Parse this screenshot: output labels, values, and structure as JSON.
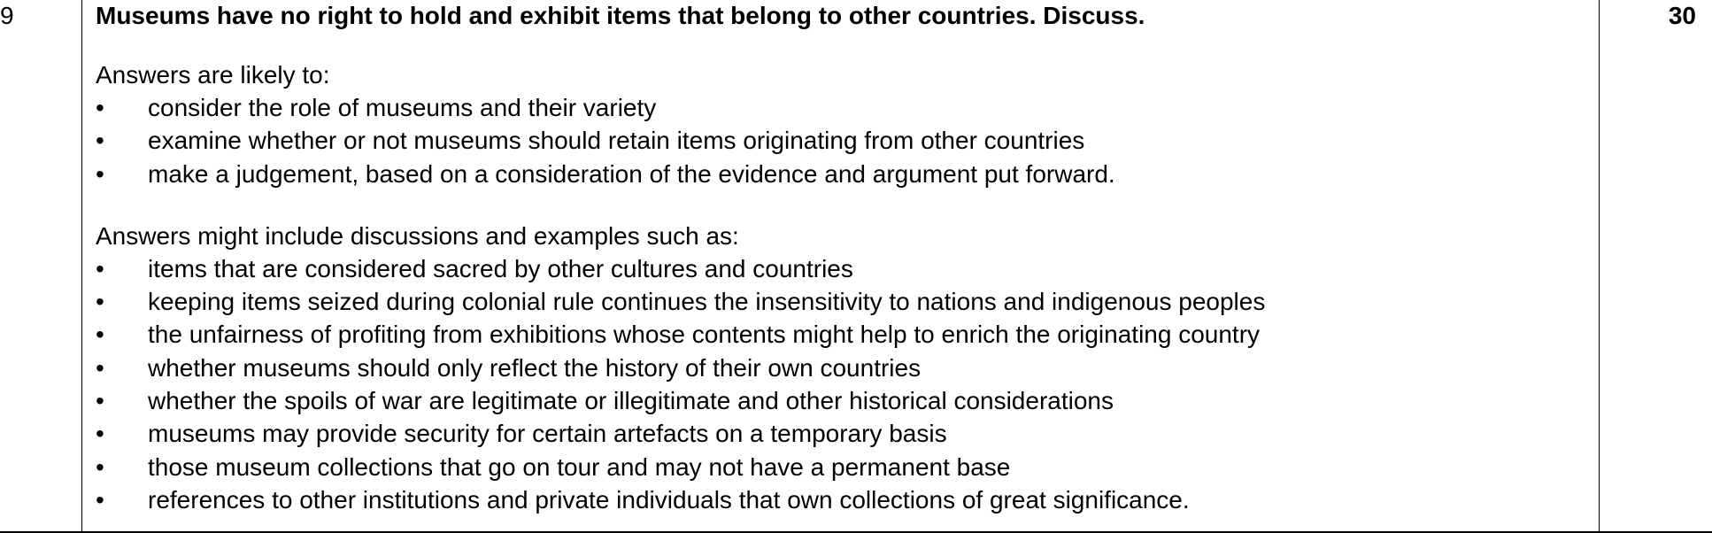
{
  "question": {
    "number": "9",
    "text": "Museums have no right to hold and exhibit items that belong to other countries. Discuss.",
    "marks": "30"
  },
  "sections": [
    {
      "title": "Answers are likely to:",
      "items": [
        "consider the role of museums and their variety",
        "examine whether or not museums should retain items originating from other countries",
        "make a judgement, based on a consideration of the evidence and argument put forward."
      ]
    },
    {
      "title": "Answers might include discussions and examples such as:",
      "items": [
        "items that are considered sacred by other cultures and countries",
        "keeping items seized during colonial rule continues the insensitivity to nations and indigenous peoples",
        "the unfairness of profiting from exhibitions whose contents might help to enrich the originating country",
        "whether museums should only reflect the history of their own countries",
        "whether the spoils of war are legitimate or illegitimate and other historical considerations",
        "museums may provide security for certain artefacts on a temporary basis",
        "those museum collections that go on tour and may not have a permanent base",
        "references to other institutions and private individuals that own collections of great significance."
      ]
    }
  ],
  "bullet_glyph": "•"
}
